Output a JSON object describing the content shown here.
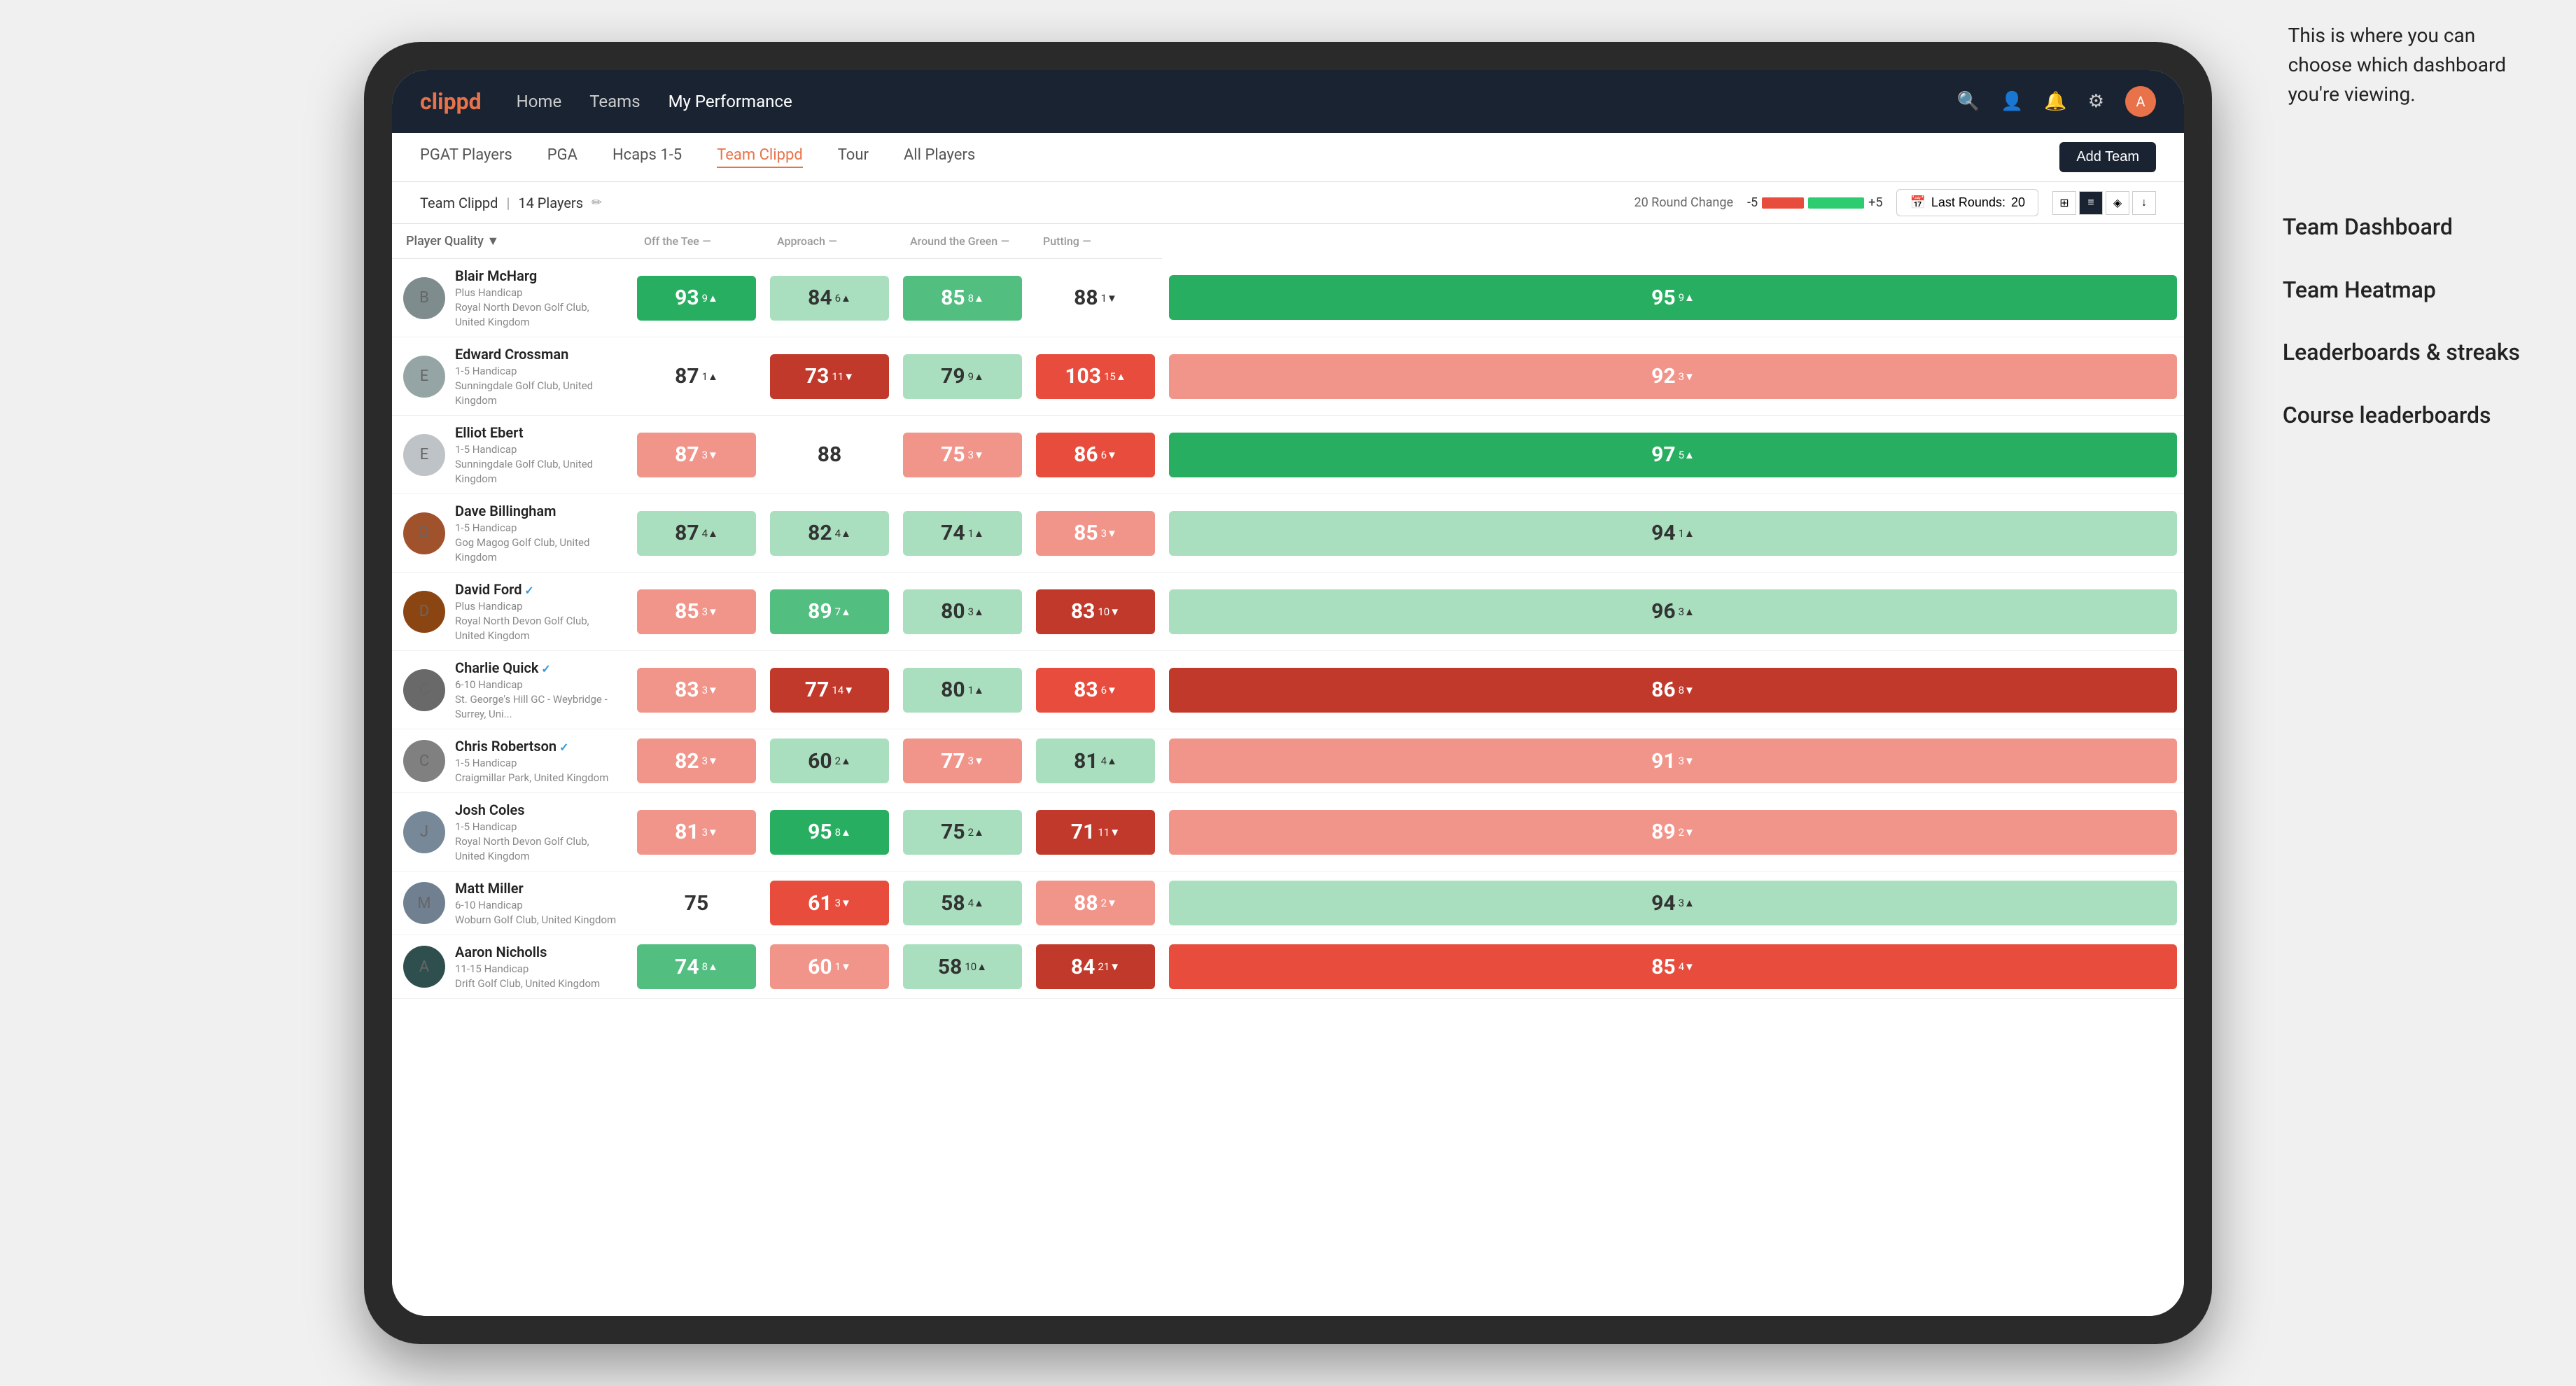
{
  "annotation": {
    "line1": "This is where you can",
    "line2": "choose which dashboard",
    "line3": "you're viewing."
  },
  "dashboard_options": [
    "Team Dashboard",
    "Team Heatmap",
    "Leaderboards & streaks",
    "Course leaderboards"
  ],
  "nav": {
    "logo": "clippd",
    "links": [
      "Home",
      "Teams",
      "My Performance"
    ],
    "active": "My Performance"
  },
  "sub_nav": {
    "links": [
      "PGAT Players",
      "PGA",
      "Hcaps 1-5",
      "Team Clippd",
      "Tour",
      "All Players"
    ],
    "active": "Team Clippd",
    "add_team": "Add Team"
  },
  "team_bar": {
    "name": "Team Clippd",
    "count": "14 Players",
    "round_change_label": "20 Round Change",
    "round_neg": "-5",
    "round_pos": "+5",
    "last_rounds_label": "Last Rounds:",
    "last_rounds_value": "20"
  },
  "table": {
    "columns": [
      {
        "id": "player",
        "label": "Player Quality",
        "sub": "▼"
      },
      {
        "id": "off_tee",
        "label": "Off the Tee",
        "sub": "—"
      },
      {
        "id": "approach",
        "label": "Approach",
        "sub": "—"
      },
      {
        "id": "around_green",
        "label": "Around the Green",
        "sub": "—"
      },
      {
        "id": "putting",
        "label": "Putting",
        "sub": "—"
      }
    ],
    "rows": [
      {
        "name": "Blair McHarg",
        "hcap": "Plus Handicap",
        "club": "Royal North Devon Golf Club, United Kingdom",
        "quality": {
          "value": 93,
          "change": "+9",
          "dir": "up",
          "color": "green-dark"
        },
        "off_tee": {
          "value": 84,
          "change": "+6",
          "dir": "up",
          "color": "green-light"
        },
        "approach": {
          "value": 85,
          "change": "+8",
          "dir": "up",
          "color": "green-med"
        },
        "around_green": {
          "value": 88,
          "change": "-1",
          "dir": "down",
          "color": "white"
        },
        "putting": {
          "value": 95,
          "change": "+9",
          "dir": "up",
          "color": "green-dark"
        }
      },
      {
        "name": "Edward Crossman",
        "hcap": "1-5 Handicap",
        "club": "Sunningdale Golf Club, United Kingdom",
        "quality": {
          "value": 87,
          "change": "+1",
          "dir": "up",
          "color": "white"
        },
        "off_tee": {
          "value": 73,
          "change": "-11",
          "dir": "down",
          "color": "red-dark"
        },
        "approach": {
          "value": 79,
          "change": "+9",
          "dir": "up",
          "color": "green-light"
        },
        "around_green": {
          "value": 103,
          "change": "+15",
          "dir": "up",
          "color": "red-med"
        },
        "putting": {
          "value": 92,
          "change": "-3",
          "dir": "down",
          "color": "red-light"
        }
      },
      {
        "name": "Elliot Ebert",
        "hcap": "1-5 Handicap",
        "club": "Sunningdale Golf Club, United Kingdom",
        "quality": {
          "value": 87,
          "change": "-3",
          "dir": "down",
          "color": "red-light"
        },
        "off_tee": {
          "value": 88,
          "change": "",
          "dir": "none",
          "color": "white"
        },
        "approach": {
          "value": 75,
          "change": "-3",
          "dir": "down",
          "color": "red-light"
        },
        "around_green": {
          "value": 86,
          "change": "-6",
          "dir": "down",
          "color": "red-med"
        },
        "putting": {
          "value": 97,
          "change": "+5",
          "dir": "up",
          "color": "green-dark"
        }
      },
      {
        "name": "Dave Billingham",
        "hcap": "1-5 Handicap",
        "club": "Gog Magog Golf Club, United Kingdom",
        "quality": {
          "value": 87,
          "change": "+4",
          "dir": "up",
          "color": "green-light"
        },
        "off_tee": {
          "value": 82,
          "change": "+4",
          "dir": "up",
          "color": "green-light"
        },
        "approach": {
          "value": 74,
          "change": "+1",
          "dir": "up",
          "color": "green-light"
        },
        "around_green": {
          "value": 85,
          "change": "-3",
          "dir": "down",
          "color": "red-light"
        },
        "putting": {
          "value": 94,
          "change": "+1",
          "dir": "up",
          "color": "green-light"
        }
      },
      {
        "name": "David Ford",
        "hcap": "Plus Handicap",
        "club": "Royal North Devon Golf Club, United Kingdom",
        "verified": true,
        "quality": {
          "value": 85,
          "change": "-3",
          "dir": "down",
          "color": "red-light"
        },
        "off_tee": {
          "value": 89,
          "change": "+7",
          "dir": "up",
          "color": "green-med"
        },
        "approach": {
          "value": 80,
          "change": "+3",
          "dir": "up",
          "color": "green-light"
        },
        "around_green": {
          "value": 83,
          "change": "-10",
          "dir": "down",
          "color": "red-dark"
        },
        "putting": {
          "value": 96,
          "change": "+3",
          "dir": "up",
          "color": "green-light"
        }
      },
      {
        "name": "Charlie Quick",
        "hcap": "6-10 Handicap",
        "club": "St. George's Hill GC - Weybridge - Surrey, Uni...",
        "verified": true,
        "quality": {
          "value": 83,
          "change": "-3",
          "dir": "down",
          "color": "red-light"
        },
        "off_tee": {
          "value": 77,
          "change": "-14",
          "dir": "down",
          "color": "red-dark"
        },
        "approach": {
          "value": 80,
          "change": "+1",
          "dir": "up",
          "color": "green-light"
        },
        "around_green": {
          "value": 83,
          "change": "-6",
          "dir": "down",
          "color": "red-med"
        },
        "putting": {
          "value": 86,
          "change": "-8",
          "dir": "down",
          "color": "red-dark"
        }
      },
      {
        "name": "Chris Robertson",
        "hcap": "1-5 Handicap",
        "club": "Craigmillar Park, United Kingdom",
        "verified": true,
        "quality": {
          "value": 82,
          "change": "-3",
          "dir": "down",
          "color": "red-light"
        },
        "off_tee": {
          "value": 60,
          "change": "+2",
          "dir": "up",
          "color": "green-light"
        },
        "approach": {
          "value": 77,
          "change": "-3",
          "dir": "down",
          "color": "red-light"
        },
        "around_green": {
          "value": 81,
          "change": "+4",
          "dir": "up",
          "color": "green-light"
        },
        "putting": {
          "value": 91,
          "change": "-3",
          "dir": "down",
          "color": "red-light"
        }
      },
      {
        "name": "Josh Coles",
        "hcap": "1-5 Handicap",
        "club": "Royal North Devon Golf Club, United Kingdom",
        "quality": {
          "value": 81,
          "change": "-3",
          "dir": "down",
          "color": "red-light"
        },
        "off_tee": {
          "value": 95,
          "change": "+8",
          "dir": "up",
          "color": "green-dark"
        },
        "approach": {
          "value": 75,
          "change": "+2",
          "dir": "up",
          "color": "green-light"
        },
        "around_green": {
          "value": 71,
          "change": "-11",
          "dir": "down",
          "color": "red-dark"
        },
        "putting": {
          "value": 89,
          "change": "-2",
          "dir": "down",
          "color": "red-light"
        }
      },
      {
        "name": "Matt Miller",
        "hcap": "6-10 Handicap",
        "club": "Woburn Golf Club, United Kingdom",
        "quality": {
          "value": 75,
          "change": "",
          "dir": "none",
          "color": "white"
        },
        "off_tee": {
          "value": 61,
          "change": "-3",
          "dir": "down",
          "color": "red-med"
        },
        "approach": {
          "value": 58,
          "change": "+4",
          "dir": "up",
          "color": "green-light"
        },
        "around_green": {
          "value": 88,
          "change": "-2",
          "dir": "down",
          "color": "red-light"
        },
        "putting": {
          "value": 94,
          "change": "+3",
          "dir": "up",
          "color": "green-light"
        }
      },
      {
        "name": "Aaron Nicholls",
        "hcap": "11-15 Handicap",
        "club": "Drift Golf Club, United Kingdom",
        "quality": {
          "value": 74,
          "change": "+8",
          "dir": "up",
          "color": "green-med"
        },
        "off_tee": {
          "value": 60,
          "change": "-1",
          "dir": "down",
          "color": "red-light"
        },
        "approach": {
          "value": 58,
          "change": "+10",
          "dir": "up",
          "color": "green-light"
        },
        "around_green": {
          "value": 84,
          "change": "-21",
          "dir": "down",
          "color": "red-dark"
        },
        "putting": {
          "value": 85,
          "change": "-4",
          "dir": "down",
          "color": "red-med"
        }
      }
    ]
  }
}
